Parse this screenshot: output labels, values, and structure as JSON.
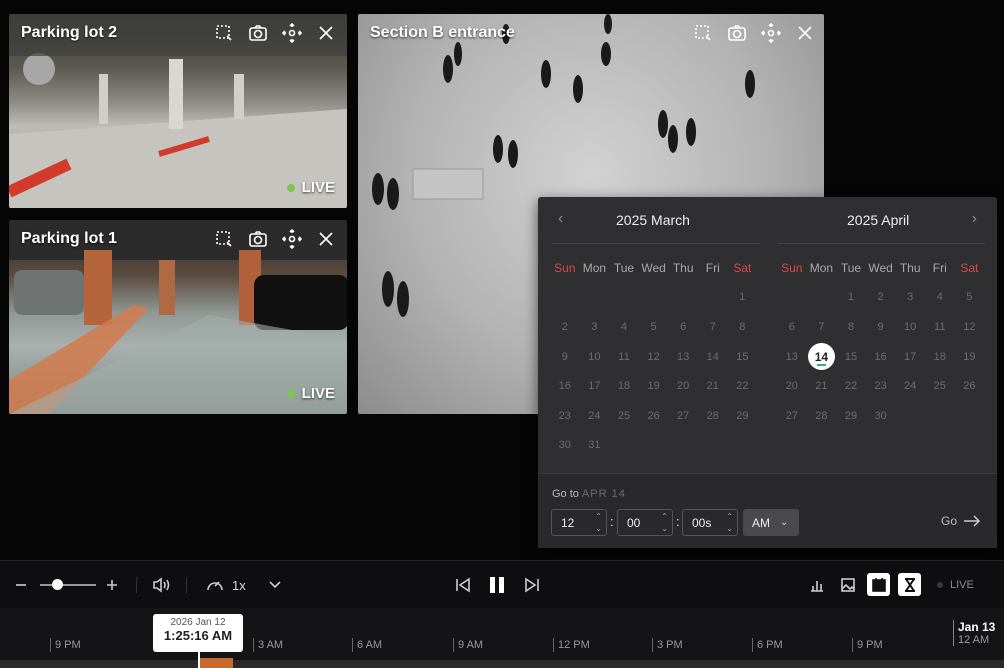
{
  "cameras": [
    {
      "title": "Parking lot 2",
      "status": "LIVE"
    },
    {
      "title": "Parking lot 1",
      "status": "LIVE"
    },
    {
      "title": "Section B entrance"
    }
  ],
  "calendar": {
    "left_month": "2025 March",
    "right_month": "2025 April",
    "weekdays": [
      "Sun",
      "Mon",
      "Tue",
      "Wed",
      "Thu",
      "Fri",
      "Sat"
    ],
    "march_days": [
      "",
      "",
      "",
      "",
      "",
      "",
      "1",
      "2",
      "3",
      "4",
      "5",
      "6",
      "7",
      "8",
      "9",
      "10",
      "11",
      "12",
      "13",
      "14",
      "15",
      "16",
      "17",
      "18",
      "19",
      "20",
      "21",
      "22",
      "23",
      "24",
      "25",
      "26",
      "27",
      "28",
      "29",
      "30",
      "31"
    ],
    "april_days": [
      "",
      "",
      "1",
      "2",
      "3",
      "4",
      "5",
      "6",
      "7",
      "8",
      "9",
      "10",
      "11",
      "12",
      "13",
      "14",
      "15",
      "16",
      "17",
      "18",
      "19",
      "20",
      "21",
      "22",
      "23",
      "24",
      "25",
      "26",
      "27",
      "28",
      "29",
      "30"
    ],
    "selected_day": "14",
    "goto_label": "Go to",
    "goto_date": "APR 14",
    "hour": "12",
    "minute": "00",
    "second": "00s",
    "ampm": "AM",
    "go_label": "Go"
  },
  "controls": {
    "speed": "1x",
    "live_label": "LIVE"
  },
  "timeline": {
    "ticks": [
      "9 PM",
      "3 AM",
      "6 AM",
      "9 AM",
      "12 PM",
      "3 PM",
      "6 PM",
      "9 PM"
    ],
    "cursor_date": "2026 Jan 12",
    "cursor_time": "1:25:16 AM",
    "day_label": "Jan 13",
    "day_time": "12 AM"
  },
  "colors": {
    "accent": "#c96a2a",
    "live": "#7bc74d",
    "weekend": "#d74a4a"
  }
}
